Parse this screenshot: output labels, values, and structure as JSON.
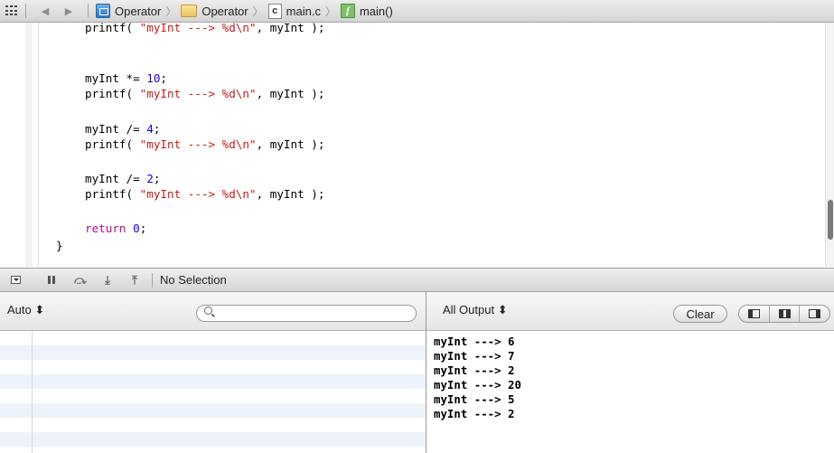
{
  "jumpbar": {
    "icons": [
      "related-items-grid-icon",
      "back-arrow-icon",
      "forward-arrow-icon",
      "project-icon",
      "folder-icon",
      "c-file-icon",
      "function-icon"
    ],
    "back_glyph": "◀",
    "forward_glyph": "▶",
    "chevron_glyph": "〉",
    "crumbs": [
      {
        "label": "Operator"
      },
      {
        "label": "Operator"
      },
      {
        "label": "main.c",
        "icon_text": "c"
      },
      {
        "label": "main()",
        "icon_text": "f"
      }
    ]
  },
  "editor": {
    "code": [
      {
        "pre": "printf( ",
        "str": "\"myInt ---> %d\\n\"",
        "post": ", myInt );"
      },
      {
        "pre": "myInt *= ",
        "num": "10",
        "post": ";"
      },
      {
        "pre": "printf( ",
        "str": "\"myInt ---> %d\\n\"",
        "post": ", myInt );"
      },
      {
        "pre": "myInt /= ",
        "num": "4",
        "post": ";"
      },
      {
        "pre": "printf( ",
        "str": "\"myInt ---> %d\\n\"",
        "post": ", myInt );"
      },
      {
        "pre": "myInt /= ",
        "num": "2",
        "post": ";"
      },
      {
        "pre": "printf( ",
        "str": "\"myInt ---> %d\\n\"",
        "post": ", myInt );"
      },
      {
        "kw": "return",
        "num": "0",
        "post": ";"
      },
      {
        "brace": "}"
      }
    ]
  },
  "debugbar": {
    "icons": [
      "toggle-console-icon",
      "pause-icon",
      "step-over-icon",
      "step-into-icon",
      "step-out-icon"
    ],
    "step_over_glyph": "⤼",
    "step_into_glyph": "⤓",
    "step_out_glyph": "⤒",
    "selection_label": "No Selection"
  },
  "variables": {
    "scope_label": "Auto ⬍",
    "search_placeholder": ""
  },
  "console": {
    "filter_label": "All Output ⬍",
    "clear_label": "Clear",
    "output": [
      "myInt ---> 6",
      "myInt ---> 7",
      "myInt ---> 2",
      "myInt ---> 20",
      "myInt ---> 5",
      "myInt ---> 2"
    ]
  }
}
